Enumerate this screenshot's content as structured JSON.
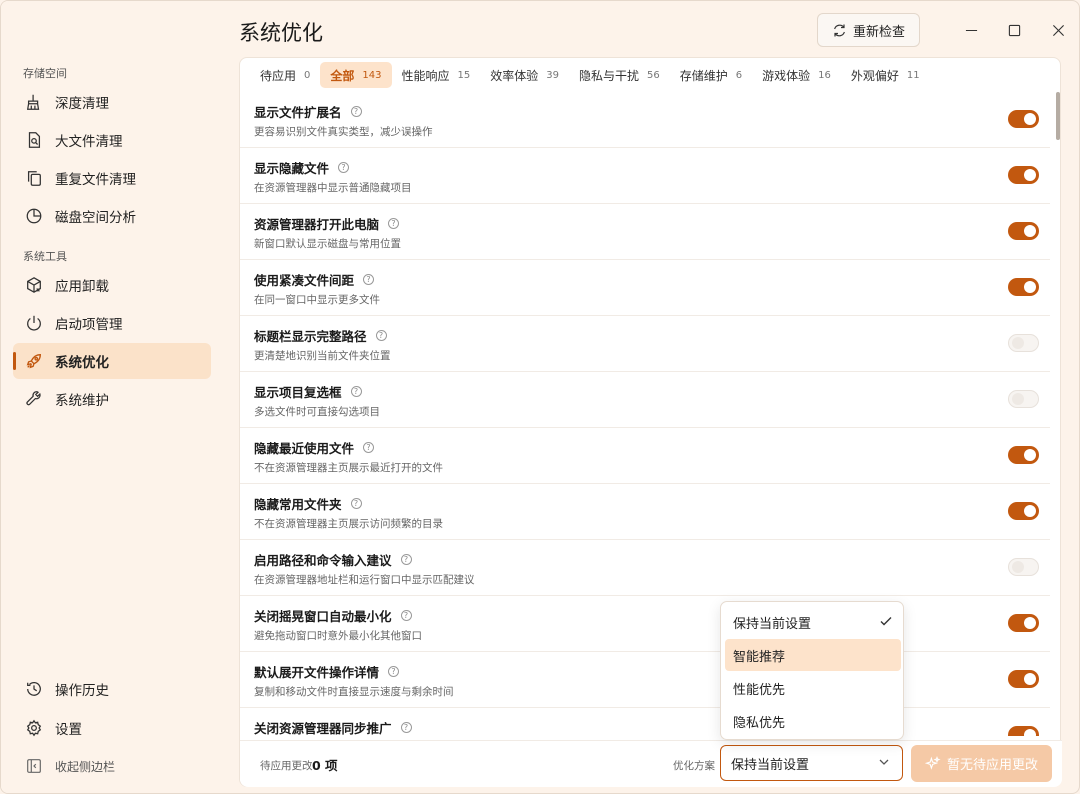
{
  "app": {
    "page_title": "系统优化",
    "recheck_label": "重新检查"
  },
  "sidebar": {
    "section_storage": "存储空间",
    "section_tools": "系统工具",
    "items": [
      {
        "label": "深度清理",
        "icon": "broom-icon"
      },
      {
        "label": "大文件清理",
        "icon": "file-search-icon"
      },
      {
        "label": "重复文件清理",
        "icon": "copy-icon"
      },
      {
        "label": "磁盘空间分析",
        "icon": "pie-chart-icon"
      },
      {
        "label": "应用卸载",
        "icon": "package-remove-icon"
      },
      {
        "label": "启动项管理",
        "icon": "power-icon"
      },
      {
        "label": "系统优化",
        "icon": "rocket-icon",
        "active": true
      },
      {
        "label": "系统维护",
        "icon": "wrench-icon"
      }
    ],
    "history_label": "操作历史",
    "settings_label": "设置",
    "collapse_label": "收起侧边栏"
  },
  "tabs": [
    {
      "label": "待应用",
      "count": "0"
    },
    {
      "label": "全部",
      "count": "143",
      "active": true
    },
    {
      "label": "性能响应",
      "count": "15"
    },
    {
      "label": "效率体验",
      "count": "39"
    },
    {
      "label": "隐私与干扰",
      "count": "56"
    },
    {
      "label": "存储维护",
      "count": "6"
    },
    {
      "label": "游戏体验",
      "count": "16"
    },
    {
      "label": "外观偏好",
      "count": "11"
    }
  ],
  "settings": [
    {
      "title": "显示文件扩展名",
      "desc": "更容易识别文件真实类型，减少误操作",
      "on": true
    },
    {
      "title": "显示隐藏文件",
      "desc": "在资源管理器中显示普通隐藏项目",
      "on": true
    },
    {
      "title": "资源管理器打开此电脑",
      "desc": "新窗口默认显示磁盘与常用位置",
      "on": true
    },
    {
      "title": "使用紧凑文件间距",
      "desc": "在同一窗口中显示更多文件",
      "on": true
    },
    {
      "title": "标题栏显示完整路径",
      "desc": "更清楚地识别当前文件夹位置",
      "on": false
    },
    {
      "title": "显示项目复选框",
      "desc": "多选文件时可直接勾选项目",
      "on": false
    },
    {
      "title": "隐藏最近使用文件",
      "desc": "不在资源管理器主页展示最近打开的文件",
      "on": true
    },
    {
      "title": "隐藏常用文件夹",
      "desc": "不在资源管理器主页展示访问频繁的目录",
      "on": true
    },
    {
      "title": "启用路径和命令输入建议",
      "desc": "在资源管理器地址栏和运行窗口中显示匹配建议",
      "on": false
    },
    {
      "title": "关闭摇晃窗口自动最小化",
      "desc": "避免拖动窗口时意外最小化其他窗口",
      "on": true
    },
    {
      "title": "默认展开文件操作详情",
      "desc": "复制和移动文件时直接显示速度与剩余时间",
      "on": true
    },
    {
      "title": "关闭资源管理器同步推广",
      "desc": "",
      "on": true
    }
  ],
  "footer": {
    "pending_label": "待应用更改",
    "pending_count": "0 项",
    "scheme_label": "优化方案",
    "scheme_value": "保持当前设置",
    "apply_label": "暂无待应用更改"
  },
  "dropdown": {
    "options": [
      "保持当前设置",
      "智能推荐",
      "性能优先",
      "隐私优先"
    ],
    "selected": "保持当前设置",
    "highlighted": "智能推荐"
  },
  "colors": {
    "accent": "#c2580f",
    "accent_light": "#fde3cb",
    "background": "#fdf3ea"
  }
}
